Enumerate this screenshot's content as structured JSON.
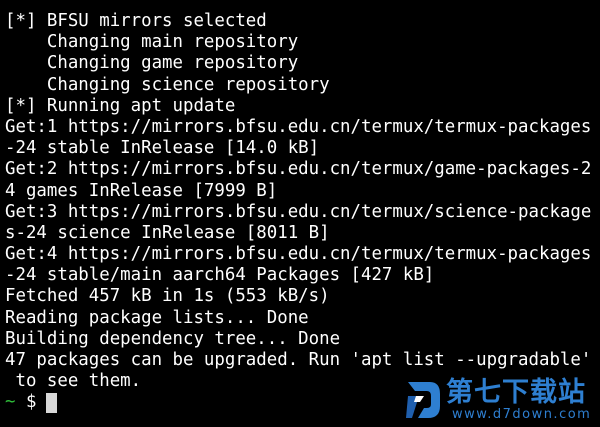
{
  "terminal": {
    "lines": [
      "[*] BFSU mirrors selected",
      "    Changing main repository",
      "    Changing game repository",
      "    Changing science repository",
      "[*] Running apt update",
      "Get:1 https://mirrors.bfsu.edu.cn/termux/termux-packages",
      "-24 stable InRelease [14.0 kB]",
      "Get:2 https://mirrors.bfsu.edu.cn/termux/game-packages-2",
      "4 games InRelease [7999 B]",
      "Get:3 https://mirrors.bfsu.edu.cn/termux/science-package",
      "s-24 science InRelease [8011 B]",
      "Get:4 https://mirrors.bfsu.edu.cn/termux/termux-packages",
      "-24 stable/main aarch64 Packages [427 kB]",
      "Fetched 457 kB in 1s (553 kB/s)",
      "Reading package lists... Done",
      "Building dependency tree... Done",
      "47 packages can be upgraded. Run 'apt list --upgradable'",
      " to see them."
    ],
    "prompt": {
      "tilde": "~",
      "symbol": "$"
    }
  },
  "watermark": {
    "title": "第七下载站",
    "url": "www.d7down.com",
    "color": "#2e7fd1"
  },
  "colors": {
    "background": "#000000",
    "foreground": "#ffffff",
    "prompt_tilde": "#2fbf3a",
    "cursor": "#d8d8d8"
  }
}
